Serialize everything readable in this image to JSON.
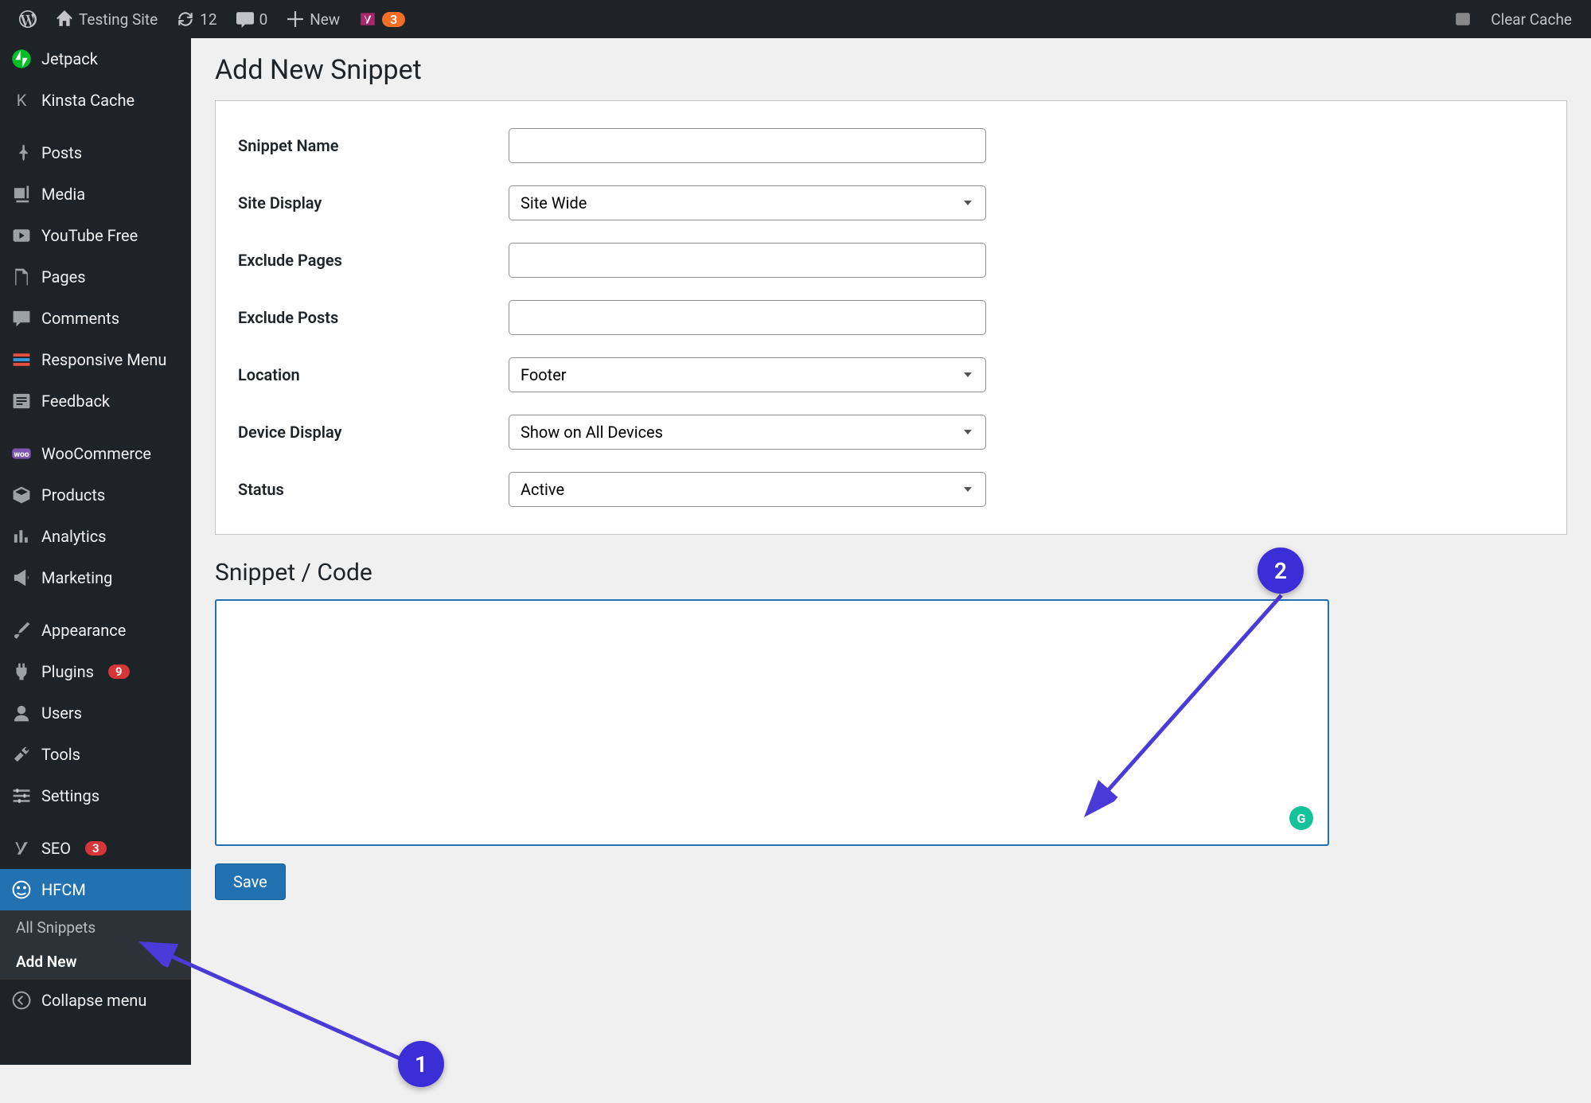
{
  "adminbar": {
    "site_name": "Testing Site",
    "updates_count": "12",
    "comments_count": "0",
    "new_label": "New",
    "yoast_count": "3",
    "clear_cache": "Clear Cache"
  },
  "sidebar": {
    "items": [
      {
        "label": "Jetpack",
        "icon": "jetpack"
      },
      {
        "label": "Kinsta Cache",
        "icon": "kinsta"
      },
      {
        "label": "Posts",
        "icon": "pin"
      },
      {
        "label": "Media",
        "icon": "media"
      },
      {
        "label": "YouTube Free",
        "icon": "video"
      },
      {
        "label": "Pages",
        "icon": "pages"
      },
      {
        "label": "Comments",
        "icon": "comment"
      },
      {
        "label": "Responsive Menu",
        "icon": "resp"
      },
      {
        "label": "Feedback",
        "icon": "feedback"
      },
      {
        "label": "WooCommerce",
        "icon": "woo"
      },
      {
        "label": "Products",
        "icon": "box"
      },
      {
        "label": "Analytics",
        "icon": "chart"
      },
      {
        "label": "Marketing",
        "icon": "megaphone"
      },
      {
        "label": "Appearance",
        "icon": "brush"
      },
      {
        "label": "Plugins",
        "icon": "plug",
        "badge": "9"
      },
      {
        "label": "Users",
        "icon": "user"
      },
      {
        "label": "Tools",
        "icon": "wrench"
      },
      {
        "label": "Settings",
        "icon": "settings"
      },
      {
        "label": "SEO",
        "icon": "yoast",
        "badge": "3"
      },
      {
        "label": "HFCM",
        "icon": "hfcm",
        "current": true
      }
    ],
    "submenu": [
      {
        "label": "All Snippets"
      },
      {
        "label": "Add New",
        "current": true
      }
    ],
    "collapse": "Collapse menu"
  },
  "page": {
    "title": "Add New Snippet",
    "code_heading": "Snippet / Code",
    "save": "Save"
  },
  "form": {
    "snippet_name_label": "Snippet Name",
    "snippet_name_value": "",
    "site_display_label": "Site Display",
    "site_display_value": "Site Wide",
    "exclude_pages_label": "Exclude Pages",
    "exclude_posts_label": "Exclude Posts",
    "location_label": "Location",
    "location_value": "Footer",
    "device_display_label": "Device Display",
    "device_display_value": "Show on All Devices",
    "status_label": "Status",
    "status_value": "Active"
  },
  "annotations": {
    "one": "1",
    "two": "2"
  }
}
